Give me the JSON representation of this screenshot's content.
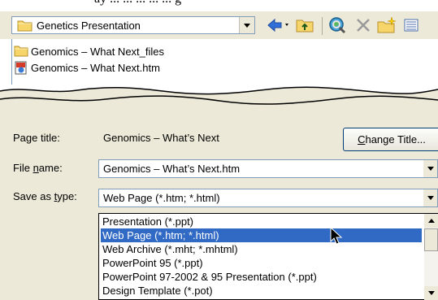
{
  "save_in": {
    "folder_name": "Genetics Presentation",
    "icon": "folder-icon"
  },
  "top_clip_text": "ay ... ... ... ... ... g",
  "toolbar": {
    "icons": [
      "back-arrow-icon",
      "up-folder-icon",
      "search-web-icon",
      "delete-icon",
      "new-folder-icon",
      "views-icon"
    ]
  },
  "files": [
    {
      "name": "Genomics – What Next_files",
      "icon": "folder-icon"
    },
    {
      "name": "Genomics – What Next.htm",
      "icon": "html-document-icon"
    }
  ],
  "page_title": {
    "label": "Page title:",
    "value": "Genomics – What’s Next"
  },
  "change_title_button": {
    "prefix": "",
    "accel": "C",
    "rest": "hange Title..."
  },
  "file_name": {
    "label_pre": "File ",
    "label_accel": "n",
    "label_post": "ame:",
    "value": "Genomics – What’s Next.htm"
  },
  "save_as_type": {
    "label_pre": "Save as ",
    "label_accel": "t",
    "label_post": "ype:",
    "value": "Web Page (*.htm; *.html)"
  },
  "type_options": [
    {
      "label": "Presentation (*.ppt)",
      "selected": false
    },
    {
      "label": "Web Page (*.htm; *.html)",
      "selected": true
    },
    {
      "label": "Web Archive (*.mht; *.mhtml)",
      "selected": false
    },
    {
      "label": "PowerPoint 95 (*.ppt)",
      "selected": false
    },
    {
      "label": "PowerPoint 97-2002 & 95 Presentation (*.ppt)",
      "selected": false
    },
    {
      "label": "Design Template (*.pot)",
      "selected": false
    }
  ],
  "colors": {
    "selection": "#316ac5",
    "dialog_bg": "#ece9d8",
    "border": "#7f9db9"
  }
}
